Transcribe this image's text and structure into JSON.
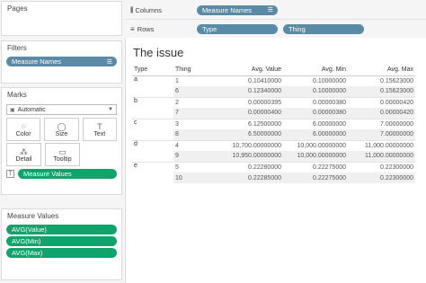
{
  "pages": {
    "title": "Pages"
  },
  "filters": {
    "title": "Filters",
    "items": [
      "Measure Names"
    ]
  },
  "marks": {
    "title": "Marks",
    "type_selected": "Automatic",
    "buttons": [
      "Color",
      "Size",
      "Text",
      "Detail",
      "Tooltip"
    ],
    "text_field": "Measure Values"
  },
  "measure_values": {
    "title": "Measure Values",
    "items": [
      "AVG(Value)",
      "AVG(Min)",
      "AVG(Max)"
    ]
  },
  "columns": {
    "label": "Columns",
    "pills": [
      "Measure Names"
    ]
  },
  "rows": {
    "label": "Rows",
    "pills": [
      "Type",
      "Thing"
    ]
  },
  "view": {
    "title": "The issue",
    "headers": [
      "Type",
      "Thing",
      "Avg. Value",
      "Avg. Min",
      "Avg. Max"
    ],
    "rows": [
      [
        "a",
        "1",
        "0.10410000",
        "0.10000000",
        "0.15623000"
      ],
      [
        "",
        "6",
        "0.12340000",
        "0.10000000",
        "0.15623000"
      ],
      [
        "b",
        "2",
        "0.00000395",
        "0.00000380",
        "0.00000420"
      ],
      [
        "",
        "7",
        "0.00000400",
        "0.00000380",
        "0.00000420"
      ],
      [
        "c",
        "3",
        "6.12500000",
        "6.00000000",
        "7.00000000"
      ],
      [
        "",
        "8",
        "6.50000000",
        "6.00000000",
        "7.00000000"
      ],
      [
        "d",
        "4",
        "10,700.00000000",
        "10,000.00000000",
        "11,000.00000000"
      ],
      [
        "",
        "9",
        "10,950.00000000",
        "10,000.00000000",
        "11,000.00000000"
      ],
      [
        "e",
        "5",
        "0.22280000",
        "0.22275000",
        "0.22300000"
      ],
      [
        "",
        "10",
        "0.22285000",
        "0.22275000",
        "0.22300000"
      ]
    ]
  },
  "colors": {
    "dimension_pill": "#5b8aa6",
    "measure_pill": "#10a36b"
  }
}
